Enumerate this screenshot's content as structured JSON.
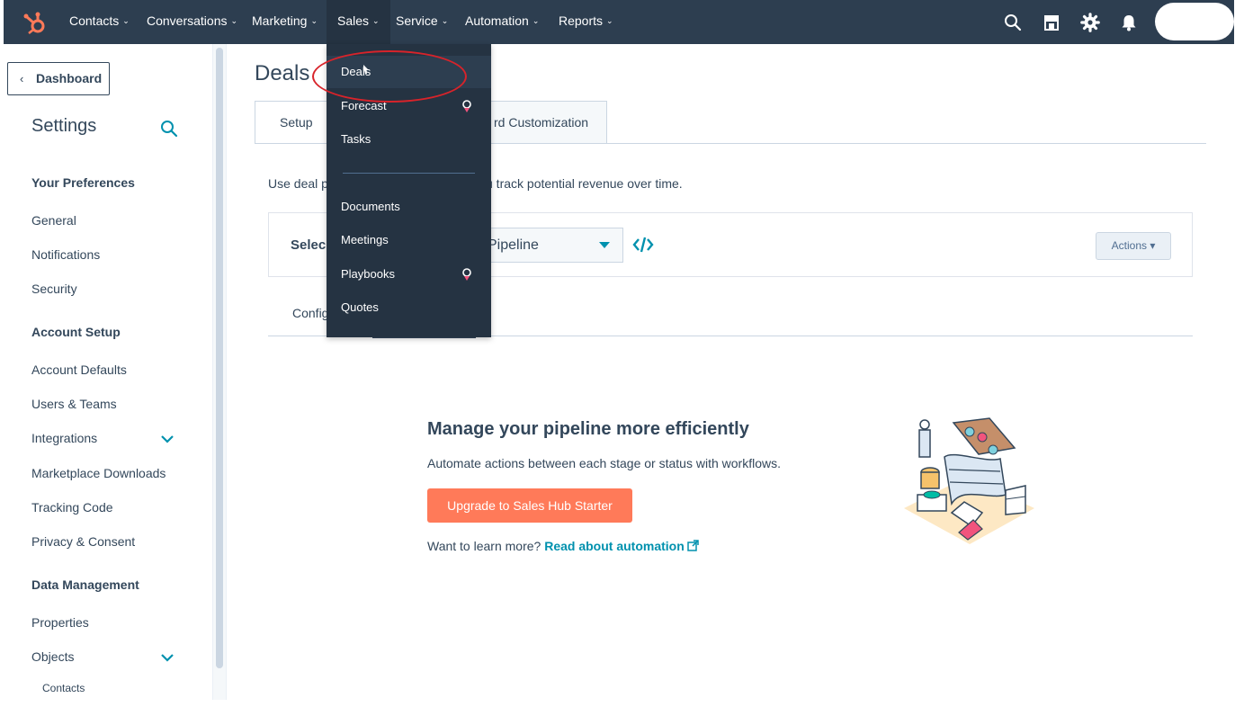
{
  "topnav": {
    "items": [
      {
        "label": "Contacts"
      },
      {
        "label": "Conversations"
      },
      {
        "label": "Marketing"
      },
      {
        "label": "Sales"
      },
      {
        "label": "Service"
      },
      {
        "label": "Automation"
      },
      {
        "label": "Reports"
      }
    ],
    "icons": [
      "search-icon",
      "marketplace-icon",
      "settings-gear-icon",
      "notifications-bell-icon"
    ],
    "colors": {
      "bar": "#2d3e50",
      "accent": "#ff7a59"
    }
  },
  "sales_menu": {
    "items": [
      {
        "label": "Deals"
      },
      {
        "label": "Forecast"
      },
      {
        "label": "Tasks"
      },
      {
        "label": "Documents"
      },
      {
        "label": "Meetings"
      },
      {
        "label": "Playbooks"
      },
      {
        "label": "Quotes"
      }
    ]
  },
  "sidebar": {
    "back_label": "Dashboard",
    "title": "Settings",
    "sections": [
      {
        "heading": "Your Preferences",
        "items": [
          "General",
          "Notifications",
          "Security"
        ]
      },
      {
        "heading": "Account Setup",
        "items": [
          "Account Defaults",
          "Users & Teams",
          "Integrations",
          "Marketplace Downloads",
          "Tracking Code",
          "Privacy & Consent"
        ]
      },
      {
        "heading": "Data Management",
        "items": [
          "Properties",
          "Objects"
        ]
      }
    ],
    "objects_sub": [
      "Contacts"
    ]
  },
  "main": {
    "title": "Deals",
    "tabs": [
      {
        "label": "Setup"
      },
      {
        "label": "rd Customization"
      }
    ],
    "description_left": "Use deal p",
    "description_right": "u track potential revenue over time.",
    "select_label": "Selec",
    "pipeline_value": "Pipeline",
    "actions_label": "Actions ▾",
    "subtab_label": "Config",
    "promo": {
      "title": "Manage your pipeline more efficiently",
      "text": "Automate actions between each stage or status with workflows.",
      "button": "Upgrade to Sales Hub Starter",
      "learn_prefix": "Want to learn more?",
      "learn_link": "Read about automation"
    }
  }
}
